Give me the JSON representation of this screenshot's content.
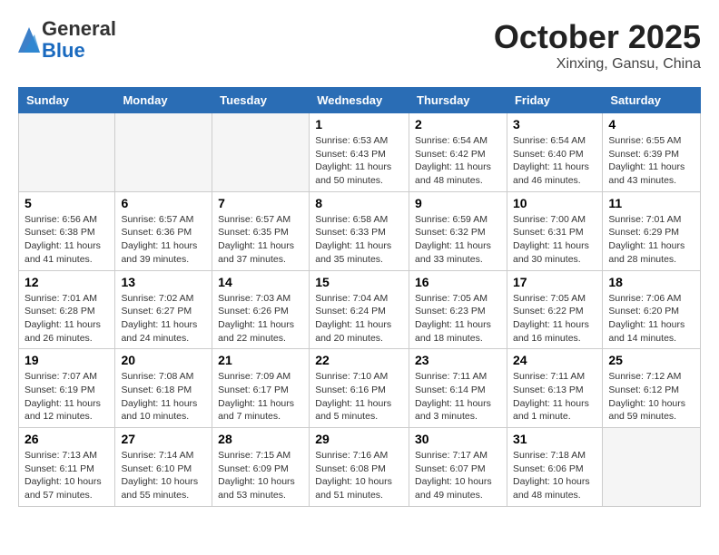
{
  "logo": {
    "general": "General",
    "blue": "Blue"
  },
  "title": "October 2025",
  "location": "Xinxing, Gansu, China",
  "days_of_week": [
    "Sunday",
    "Monday",
    "Tuesday",
    "Wednesday",
    "Thursday",
    "Friday",
    "Saturday"
  ],
  "weeks": [
    [
      {
        "day": "",
        "info": ""
      },
      {
        "day": "",
        "info": ""
      },
      {
        "day": "",
        "info": ""
      },
      {
        "day": "1",
        "info": "Sunrise: 6:53 AM\nSunset: 6:43 PM\nDaylight: 11 hours\nand 50 minutes."
      },
      {
        "day": "2",
        "info": "Sunrise: 6:54 AM\nSunset: 6:42 PM\nDaylight: 11 hours\nand 48 minutes."
      },
      {
        "day": "3",
        "info": "Sunrise: 6:54 AM\nSunset: 6:40 PM\nDaylight: 11 hours\nand 46 minutes."
      },
      {
        "day": "4",
        "info": "Sunrise: 6:55 AM\nSunset: 6:39 PM\nDaylight: 11 hours\nand 43 minutes."
      }
    ],
    [
      {
        "day": "5",
        "info": "Sunrise: 6:56 AM\nSunset: 6:38 PM\nDaylight: 11 hours\nand 41 minutes."
      },
      {
        "day": "6",
        "info": "Sunrise: 6:57 AM\nSunset: 6:36 PM\nDaylight: 11 hours\nand 39 minutes."
      },
      {
        "day": "7",
        "info": "Sunrise: 6:57 AM\nSunset: 6:35 PM\nDaylight: 11 hours\nand 37 minutes."
      },
      {
        "day": "8",
        "info": "Sunrise: 6:58 AM\nSunset: 6:33 PM\nDaylight: 11 hours\nand 35 minutes."
      },
      {
        "day": "9",
        "info": "Sunrise: 6:59 AM\nSunset: 6:32 PM\nDaylight: 11 hours\nand 33 minutes."
      },
      {
        "day": "10",
        "info": "Sunrise: 7:00 AM\nSunset: 6:31 PM\nDaylight: 11 hours\nand 30 minutes."
      },
      {
        "day": "11",
        "info": "Sunrise: 7:01 AM\nSunset: 6:29 PM\nDaylight: 11 hours\nand 28 minutes."
      }
    ],
    [
      {
        "day": "12",
        "info": "Sunrise: 7:01 AM\nSunset: 6:28 PM\nDaylight: 11 hours\nand 26 minutes."
      },
      {
        "day": "13",
        "info": "Sunrise: 7:02 AM\nSunset: 6:27 PM\nDaylight: 11 hours\nand 24 minutes."
      },
      {
        "day": "14",
        "info": "Sunrise: 7:03 AM\nSunset: 6:26 PM\nDaylight: 11 hours\nand 22 minutes."
      },
      {
        "day": "15",
        "info": "Sunrise: 7:04 AM\nSunset: 6:24 PM\nDaylight: 11 hours\nand 20 minutes."
      },
      {
        "day": "16",
        "info": "Sunrise: 7:05 AM\nSunset: 6:23 PM\nDaylight: 11 hours\nand 18 minutes."
      },
      {
        "day": "17",
        "info": "Sunrise: 7:05 AM\nSunset: 6:22 PM\nDaylight: 11 hours\nand 16 minutes."
      },
      {
        "day": "18",
        "info": "Sunrise: 7:06 AM\nSunset: 6:20 PM\nDaylight: 11 hours\nand 14 minutes."
      }
    ],
    [
      {
        "day": "19",
        "info": "Sunrise: 7:07 AM\nSunset: 6:19 PM\nDaylight: 11 hours\nand 12 minutes."
      },
      {
        "day": "20",
        "info": "Sunrise: 7:08 AM\nSunset: 6:18 PM\nDaylight: 11 hours\nand 10 minutes."
      },
      {
        "day": "21",
        "info": "Sunrise: 7:09 AM\nSunset: 6:17 PM\nDaylight: 11 hours\nand 7 minutes."
      },
      {
        "day": "22",
        "info": "Sunrise: 7:10 AM\nSunset: 6:16 PM\nDaylight: 11 hours\nand 5 minutes."
      },
      {
        "day": "23",
        "info": "Sunrise: 7:11 AM\nSunset: 6:14 PM\nDaylight: 11 hours\nand 3 minutes."
      },
      {
        "day": "24",
        "info": "Sunrise: 7:11 AM\nSunset: 6:13 PM\nDaylight: 11 hours\nand 1 minute."
      },
      {
        "day": "25",
        "info": "Sunrise: 7:12 AM\nSunset: 6:12 PM\nDaylight: 10 hours\nand 59 minutes."
      }
    ],
    [
      {
        "day": "26",
        "info": "Sunrise: 7:13 AM\nSunset: 6:11 PM\nDaylight: 10 hours\nand 57 minutes."
      },
      {
        "day": "27",
        "info": "Sunrise: 7:14 AM\nSunset: 6:10 PM\nDaylight: 10 hours\nand 55 minutes."
      },
      {
        "day": "28",
        "info": "Sunrise: 7:15 AM\nSunset: 6:09 PM\nDaylight: 10 hours\nand 53 minutes."
      },
      {
        "day": "29",
        "info": "Sunrise: 7:16 AM\nSunset: 6:08 PM\nDaylight: 10 hours\nand 51 minutes."
      },
      {
        "day": "30",
        "info": "Sunrise: 7:17 AM\nSunset: 6:07 PM\nDaylight: 10 hours\nand 49 minutes."
      },
      {
        "day": "31",
        "info": "Sunrise: 7:18 AM\nSunset: 6:06 PM\nDaylight: 10 hours\nand 48 minutes."
      },
      {
        "day": "",
        "info": ""
      }
    ]
  ]
}
